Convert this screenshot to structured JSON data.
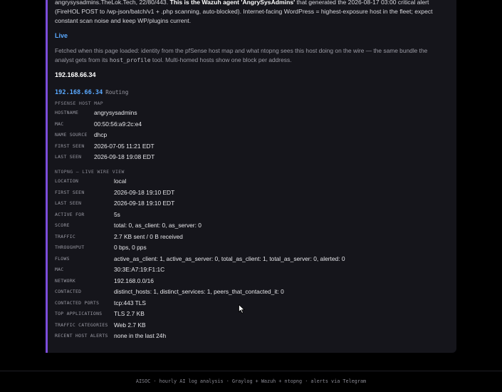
{
  "host_note": {
    "text_before": "angrysysadmins.TheLok.Tech, 22/80/443. ",
    "bold": "This is the Wazuh agent 'AngrySysAdmins'",
    "text_after": " that generated the 2026-08-17 03:00 critical alert (FireHOL POST to /wp-json/batch/v1 + .php scanning, auto-blocked). Internet-facing WordPress = highest-exposure host in the fleet; expect constant scan noise and keep WP/plugins current."
  },
  "live": {
    "heading": "Live",
    "desc_before": "Fetched when this page loaded: identity from the pfSense host map and what ntopng sees this host doing on the wire — the same bundle the analyst gets from its ",
    "desc_code": "host_profile",
    "desc_after": " tool. Multi-homed hosts show one block per address."
  },
  "ip_heading": "192.168.66.34",
  "block": {
    "ip": "192.168.66.34",
    "tag": "Routing",
    "pfsense_title": "PFSENSE HOST MAP",
    "pfsense": [
      {
        "k": "HOSTNAME",
        "v": "angrysysadmins"
      },
      {
        "k": "MAC",
        "v": "00:50:56:a9:2c:e4"
      },
      {
        "k": "NAME SOURCE",
        "v": "dhcp"
      },
      {
        "k": "FIRST SEEN",
        "v": "2026-07-05 11:21 EDT"
      },
      {
        "k": "LAST SEEN",
        "v": "2026-09-18 19:08 EDT"
      }
    ],
    "ntopng_title": "NTOPNG — LIVE WIRE VIEW",
    "ntopng": [
      {
        "k": "LOCATION",
        "v": "local"
      },
      {
        "k": "FIRST SEEN",
        "v": "2026-09-18 19:10 EDT"
      },
      {
        "k": "LAST SEEN",
        "v": "2026-09-18 19:10 EDT"
      },
      {
        "k": "ACTIVE FOR",
        "v": "5s"
      },
      {
        "k": "SCORE",
        "v": "total: 0, as_client: 0, as_server: 0"
      },
      {
        "k": "TRAFFIC",
        "v": "2.7 KB sent / 0 B received"
      },
      {
        "k": "THROUGHPUT",
        "v": "0 bps, 0 pps"
      },
      {
        "k": "FLOWS",
        "v": "active_as_client: 1, active_as_server: 0, total_as_client: 1, total_as_server: 0, alerted: 0"
      },
      {
        "k": "MAC",
        "v": "30:3E:A7:19:F1:1C"
      },
      {
        "k": "NETWORK",
        "v": "192.168.0.0/16"
      },
      {
        "k": "CONTACTED",
        "v": "distinct_hosts: 1, distinct_services: 1, peers_that_contacted_it: 0"
      },
      {
        "k": "CONTACTED PORTS",
        "v": "tcp:443 TLS"
      },
      {
        "k": "TOP APPLICATIONS",
        "v": "TLS 2.7 KB"
      },
      {
        "k": "TRAFFIC CATEGORIES",
        "v": "Web 2.7 KB"
      },
      {
        "k": "RECENT HOST ALERTS",
        "v": "none in the last 24h"
      }
    ]
  },
  "footer": "AISOC · hourly AI log analysis · Graylog + Wazuh + ntopng · alerts via Telegram"
}
